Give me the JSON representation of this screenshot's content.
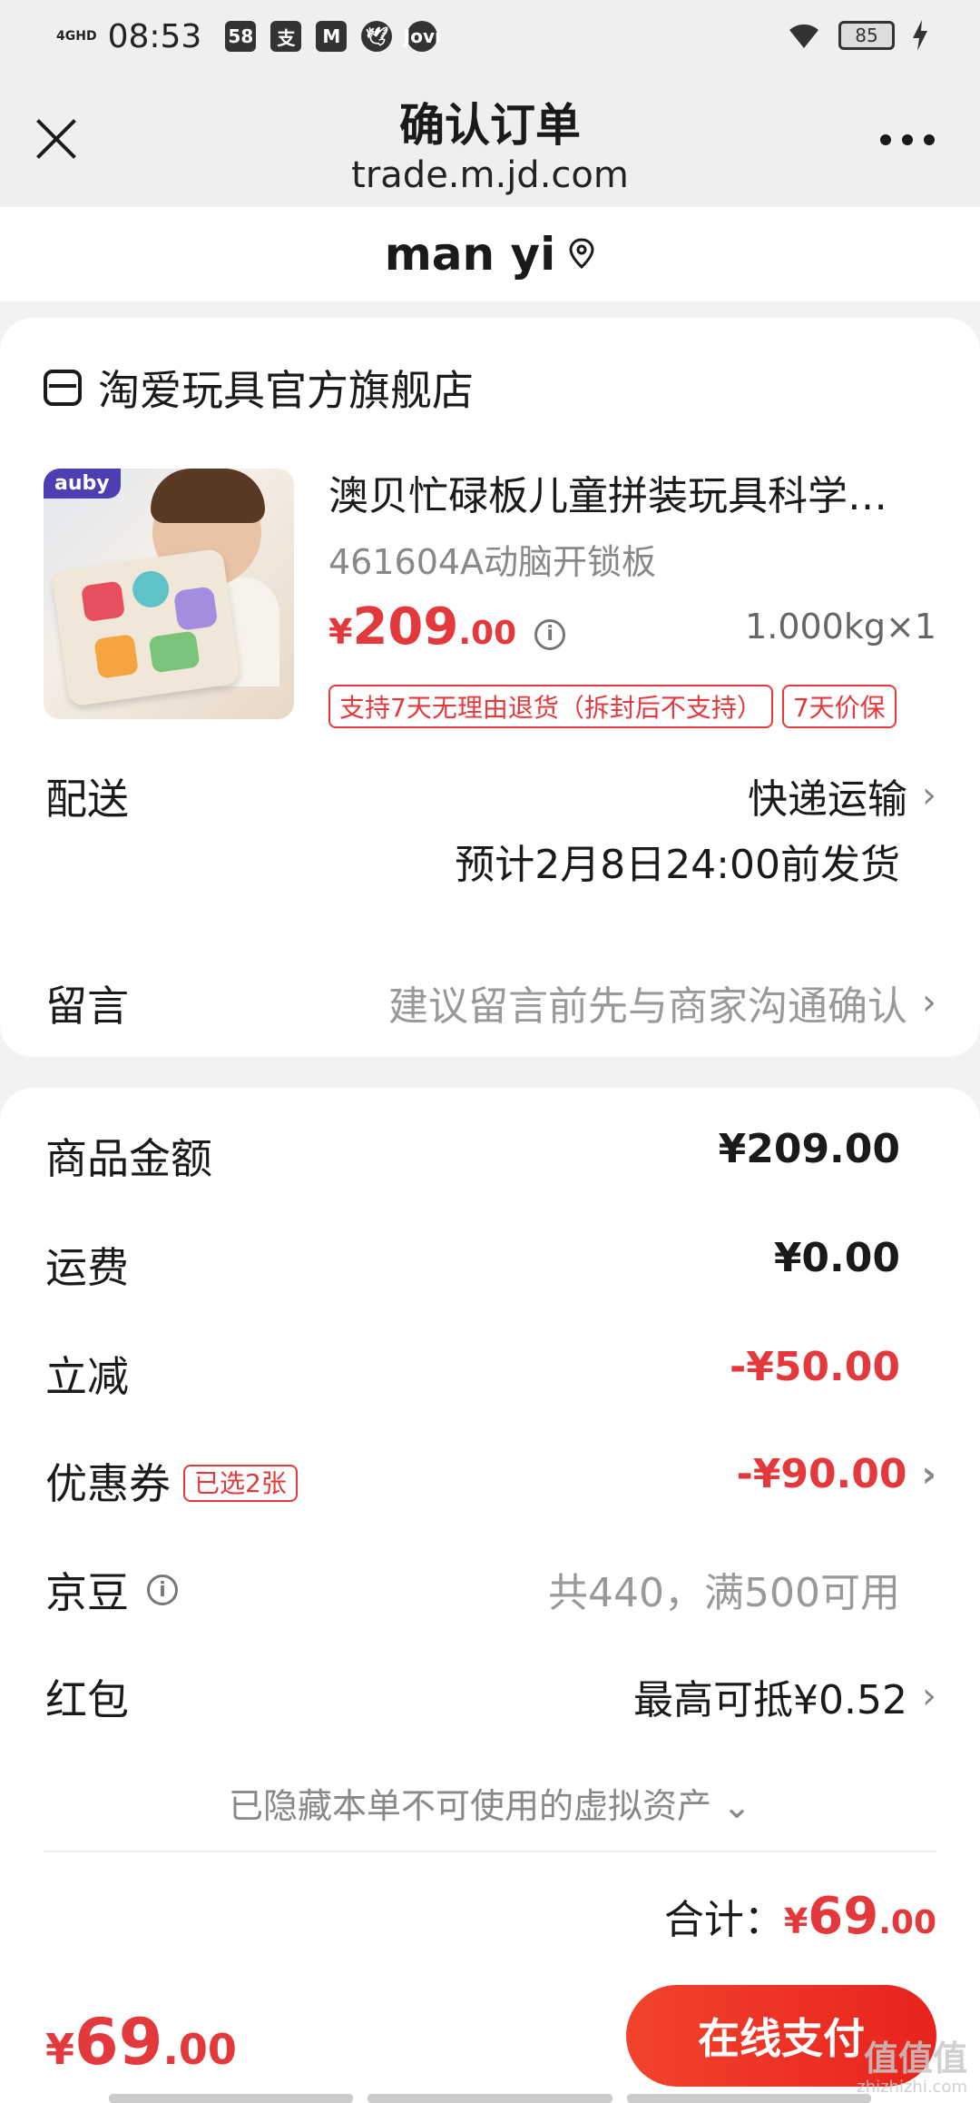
{
  "status_bar": {
    "time": "08:53",
    "network": "4GHD",
    "battery": "85",
    "app_icons": [
      "58",
      "支",
      "M",
      "🕊",
      "Jovi"
    ]
  },
  "nav": {
    "title": "确认订单",
    "url": "trade.m.jd.com"
  },
  "address": {
    "name": "man yi"
  },
  "shop": {
    "name": "淘爱玩具官方旗舰店"
  },
  "product": {
    "brand": "auby",
    "title": "澳贝忙碌板儿童拼装玩具科学…",
    "spec": "461604A动脑开锁板",
    "price_symbol": "¥",
    "price_int": "209",
    "price_dec": ".00",
    "weight_qty": "1.000kg×1",
    "tags": [
      "支持7天无理由退货（拆封后不支持）",
      "7天价保"
    ]
  },
  "delivery": {
    "label": "配送",
    "method": "快递运输",
    "estimate": "预计2月8日24:00前发货"
  },
  "message": {
    "label": "留言",
    "placeholder": "建议留言前先与商家沟通确认"
  },
  "summary": {
    "goods_label": "商品金额",
    "goods_value": "¥209.00",
    "freight_label": "运费",
    "freight_value": "¥0.00",
    "discount_label": "立减",
    "discount_value": "-¥50.00",
    "coupon_label": "优惠券",
    "coupon_badge": "已选2张",
    "coupon_value": "-¥90.00",
    "jingdou_label": "京豆",
    "jingdou_value": "共440，满500可用",
    "redpacket_label": "红包",
    "redpacket_value": "最高可抵¥0.52",
    "hidden_assets": "已隐藏本单不可使用的虚拟资产",
    "total_label": "合计：",
    "total_symbol": "¥",
    "total_int": "69",
    "total_dec": ".00"
  },
  "bottom": {
    "price_symbol": "¥",
    "price_int": "69",
    "price_dec": ".00",
    "pay_label": "在线支付"
  },
  "watermark": {
    "text": "值值值",
    "url": "zhizhizhi.com"
  },
  "colors": {
    "accent_red": "#e4393c",
    "pay_button": "#e8231d"
  }
}
